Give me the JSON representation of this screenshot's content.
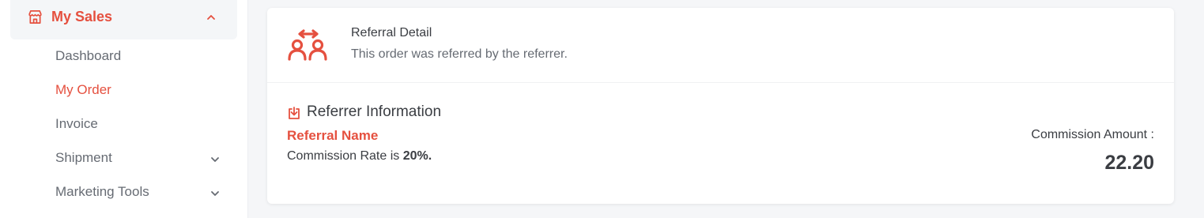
{
  "sidebar": {
    "section_label": "My Sales",
    "items": [
      {
        "label": "Dashboard"
      },
      {
        "label": "My Order"
      },
      {
        "label": "Invoice"
      },
      {
        "label": "Shipment"
      },
      {
        "label": "Marketing Tools"
      }
    ],
    "active_item": "My Order"
  },
  "referral": {
    "title": "Referral Detail",
    "subtitle": "This order was referred by the referrer."
  },
  "referrer_info": {
    "heading": "Referrer Information",
    "name": "Referral Name",
    "rate_prefix": "Commission Rate is",
    "rate_value": "20%.",
    "commission_label": "Commission Amount :",
    "commission_amount": "22.20"
  },
  "colors": {
    "accent": "#e5503f",
    "text": "#3a3d42",
    "muted": "#666b73",
    "background": "#f5f6f8"
  },
  "icons": {
    "section": "store-icon",
    "section_caret": "chevron-up-icon",
    "submenu": "chevron-down-icon",
    "referral": "referral-people-icon",
    "info": "download-box-icon"
  }
}
